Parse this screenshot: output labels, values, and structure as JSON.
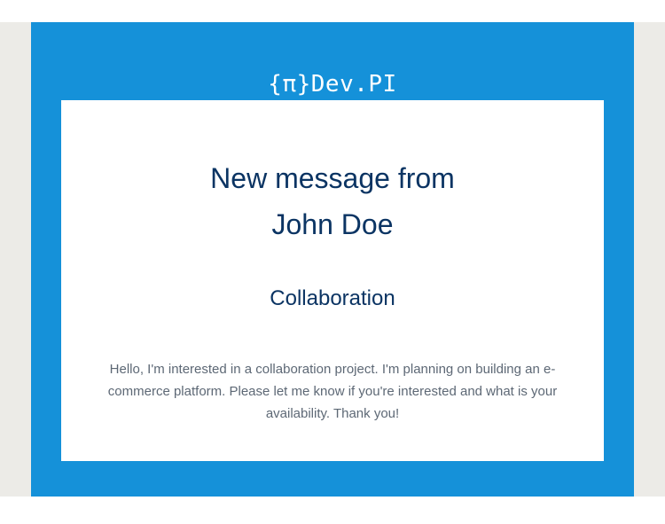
{
  "email": {
    "brand": "{π}Dev.PI",
    "heading_line1": "New message from",
    "heading_line2": "John Doe",
    "subject": "Collaboration",
    "message": "Hello, I'm interested in a collaboration project. I'm planning on building an e-commerce platform. Please let me know if you're interested and what is your availability. Thank you!"
  },
  "colors": {
    "frame": "#1591d9",
    "backdrop": "#ecebe7",
    "card": "#ffffff",
    "heading_text": "#0b3463",
    "body_text": "#5d6875"
  }
}
